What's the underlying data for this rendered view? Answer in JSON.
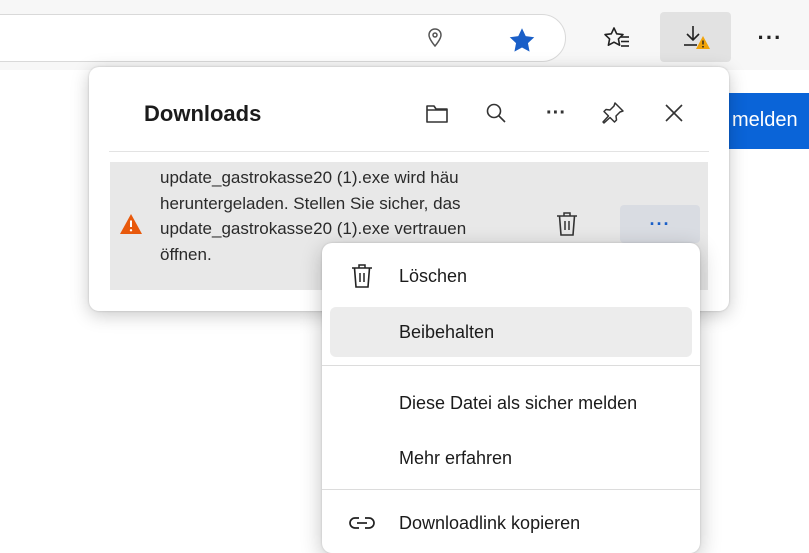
{
  "toolbar": {
    "location_icon": "location-pin-icon",
    "star_icon": "star-filled-icon",
    "favorites_icon": "favorites-icon",
    "downloads_icon": "download-warning-icon",
    "more_label": "···",
    "accent": "#1a5fc8",
    "signin_label": "melden"
  },
  "downloads_panel": {
    "title": "Downloads",
    "icons": [
      "folder-icon",
      "search-icon",
      "more-icon",
      "pin-icon",
      "close-icon"
    ],
    "more_label": "···",
    "item": {
      "warning_icon": "warning-icon",
      "warning_color": "#e8590c",
      "text": "update_gastrokasse20 (1).exe wird häu\nheruntergeladen. Stellen Sie sicher, das\nupdate_gastrokasse20 (1).exe vertrauen\nöffnen.",
      "delete_icon": "trash-icon",
      "more_label": "···"
    }
  },
  "context_menu": {
    "items": [
      {
        "label": "Löschen",
        "icon": "trash-icon"
      },
      {
        "label": "Beibehalten",
        "icon": ""
      },
      {
        "label": "Diese Datei als sicher melden",
        "icon": ""
      },
      {
        "label": "Mehr erfahren",
        "icon": ""
      },
      {
        "label": "Downloadlink kopieren",
        "icon": "link-icon"
      }
    ]
  }
}
